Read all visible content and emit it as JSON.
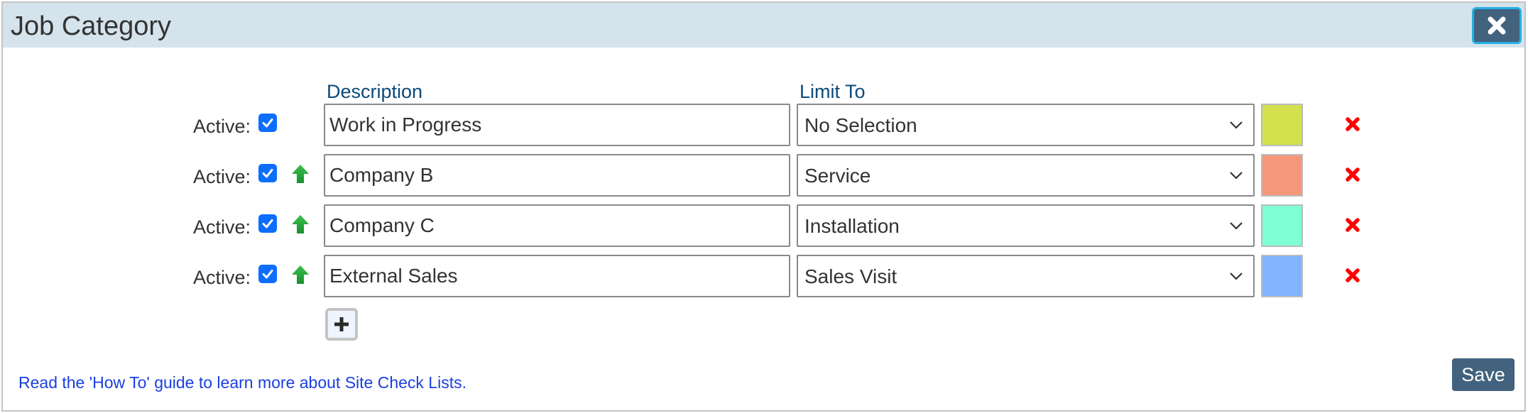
{
  "dialog": {
    "title": "Job Category",
    "close_icon": "close-icon"
  },
  "columns": {
    "description": "Description",
    "limit_to": "Limit To"
  },
  "rows": [
    {
      "active_label": "Active:",
      "active": true,
      "show_move_up": false,
      "description": "Work in Progress",
      "limit_to": "No Selection",
      "color": "#d4e04e"
    },
    {
      "active_label": "Active:",
      "active": true,
      "show_move_up": true,
      "description": "Company B",
      "limit_to": "Service",
      "color": "#f5977b"
    },
    {
      "active_label": "Active:",
      "active": true,
      "show_move_up": true,
      "description": "Company C",
      "limit_to": "Installation",
      "color": "#7fffd4"
    },
    {
      "active_label": "Active:",
      "active": true,
      "show_move_up": true,
      "description": "External Sales",
      "limit_to": "Sales Visit",
      "color": "#80b4ff"
    }
  ],
  "add_button": {
    "icon": "plus-icon"
  },
  "footer": {
    "howto_link": "Read the 'How To' guide to learn more about Site Check Lists.",
    "save_label": "Save"
  },
  "colors": {
    "header_bg": "#d4e3ec",
    "primary_button": "#42627e",
    "link": "#1a3fe0",
    "delete": "#ff0000",
    "move_up": "#22a637",
    "checkbox": "#0d6efd"
  }
}
